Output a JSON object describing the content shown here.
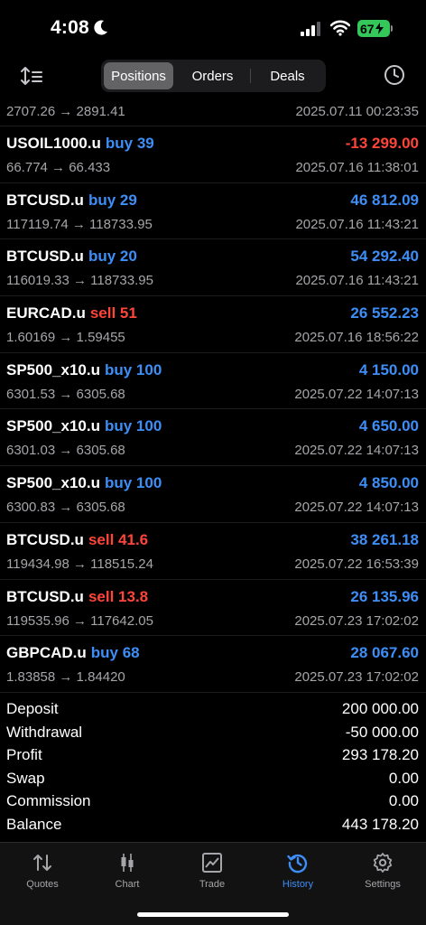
{
  "status_bar": {
    "time": "4:08",
    "battery": "67"
  },
  "header": {
    "tabs": [
      {
        "label": "Positions",
        "active": true
      },
      {
        "label": "Orders",
        "active": false
      },
      {
        "label": "Deals",
        "active": false
      }
    ]
  },
  "deals": [
    {
      "prices": "2707.26 → 2891.41",
      "date": "2025.07.11 00:23:35"
    },
    {
      "symbol": "USOIL1000.u",
      "side": "buy 39",
      "profit": "-13 299.00",
      "prices": "66.774 → 66.433",
      "date": "2025.07.16 11:38:01"
    },
    {
      "symbol": "BTCUSD.u",
      "side": "buy 29",
      "profit": "46 812.09",
      "prices": "117119.74 → 118733.95",
      "date": "2025.07.16 11:43:21"
    },
    {
      "symbol": "BTCUSD.u",
      "side": "buy 20",
      "profit": "54 292.40",
      "prices": "116019.33 → 118733.95",
      "date": "2025.07.16 11:43:21"
    },
    {
      "symbol": "EURCAD.u",
      "side": "sell 51",
      "profit": "26 552.23",
      "prices": "1.60169 → 1.59455",
      "date": "2025.07.16 18:56:22"
    },
    {
      "symbol": "SP500_x10.u",
      "side": "buy 100",
      "profit": "4 150.00",
      "prices": "6301.53 → 6305.68",
      "date": "2025.07.22 14:07:13"
    },
    {
      "symbol": "SP500_x10.u",
      "side": "buy 100",
      "profit": "4 650.00",
      "prices": "6301.03 → 6305.68",
      "date": "2025.07.22 14:07:13"
    },
    {
      "symbol": "SP500_x10.u",
      "side": "buy 100",
      "profit": "4 850.00",
      "prices": "6300.83 → 6305.68",
      "date": "2025.07.22 14:07:13"
    },
    {
      "symbol": "BTCUSD.u",
      "side": "sell 41.6",
      "profit": "38 261.18",
      "prices": "119434.98 → 118515.24",
      "date": "2025.07.22 16:53:39"
    },
    {
      "symbol": "BTCUSD.u",
      "side": "sell 13.8",
      "profit": "26 135.96",
      "prices": "119535.96 → 117642.05",
      "date": "2025.07.23 17:02:02"
    },
    {
      "symbol": "GBPCAD.u",
      "side": "buy 68",
      "profit": "28 067.60",
      "prices": "1.83858 → 1.84420",
      "date": "2025.07.23 17:02:02"
    }
  ],
  "summary": [
    {
      "label": "Deposit",
      "value": "200 000.00"
    },
    {
      "label": "Withdrawal",
      "value": "-50 000.00"
    },
    {
      "label": "Profit",
      "value": "293 178.20"
    },
    {
      "label": "Swap",
      "value": "0.00"
    },
    {
      "label": "Commission",
      "value": "0.00"
    },
    {
      "label": "Balance",
      "value": "443 178.20"
    }
  ],
  "tabbar": [
    {
      "label": "Quotes",
      "icon": "quotes-icon",
      "active": false
    },
    {
      "label": "Chart",
      "icon": "chart-icon",
      "active": false
    },
    {
      "label": "Trade",
      "icon": "trade-icon",
      "active": false
    },
    {
      "label": "History",
      "icon": "history-icon",
      "active": true
    },
    {
      "label": "Settings",
      "icon": "settings-icon",
      "active": false
    }
  ],
  "colors": {
    "buy": "#3d8ef7",
    "sell": "#ff453a",
    "active_tab": "#3d8ef7",
    "background": "#000000"
  }
}
